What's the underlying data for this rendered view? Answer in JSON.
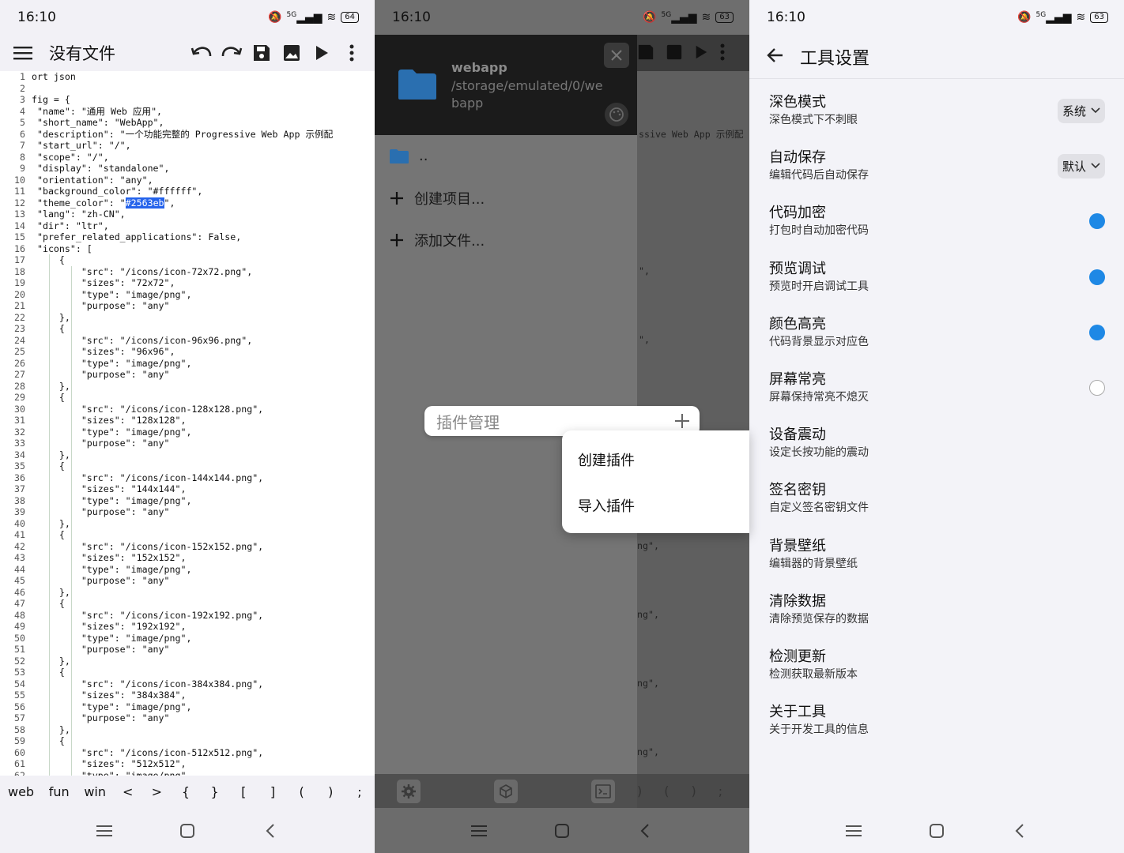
{
  "status": {
    "time": "16:10",
    "net": "5G",
    "battery_1": "64",
    "battery_2": "63",
    "battery_3": "63"
  },
  "editor": {
    "title": "没有文件",
    "lines": [
      [
        "1",
        "ort json"
      ],
      [
        "2",
        ""
      ],
      [
        "3",
        "fig = {"
      ],
      [
        "4",
        " \"name\": \"通用 Web 应用\","
      ],
      [
        "5",
        " \"short_name\": \"WebApp\","
      ],
      [
        "6",
        " \"description\": \"一个功能完整的 Progressive Web App 示例配"
      ],
      [
        "7",
        " \"start_url\": \"/\","
      ],
      [
        "8",
        " \"scope\": \"/\","
      ],
      [
        "9",
        " \"display\": \"standalone\","
      ],
      [
        "10",
        " \"orientation\": \"any\","
      ],
      [
        "11",
        " \"background_color\": \"#ffffff\","
      ],
      [
        "12",
        " \"theme_color\": \"#2563eb\","
      ],
      [
        "13",
        " \"lang\": \"zh-CN\","
      ],
      [
        "14",
        " \"dir\": \"ltr\","
      ],
      [
        "15",
        " \"prefer_related_applications\": False,"
      ],
      [
        "16",
        " \"icons\": ["
      ],
      [
        "17",
        "     {"
      ],
      [
        "18",
        "         \"src\": \"/icons/icon-72x72.png\","
      ],
      [
        "19",
        "         \"sizes\": \"72x72\","
      ],
      [
        "20",
        "         \"type\": \"image/png\","
      ],
      [
        "21",
        "         \"purpose\": \"any\""
      ],
      [
        "22",
        "     },"
      ],
      [
        "23",
        "     {"
      ],
      [
        "24",
        "         \"src\": \"/icons/icon-96x96.png\","
      ],
      [
        "25",
        "         \"sizes\": \"96x96\","
      ],
      [
        "26",
        "         \"type\": \"image/png\","
      ],
      [
        "27",
        "         \"purpose\": \"any\""
      ],
      [
        "28",
        "     },"
      ],
      [
        "29",
        "     {"
      ],
      [
        "30",
        "         \"src\": \"/icons/icon-128x128.png\","
      ],
      [
        "31",
        "         \"sizes\": \"128x128\","
      ],
      [
        "32",
        "         \"type\": \"image/png\","
      ],
      [
        "33",
        "         \"purpose\": \"any\""
      ],
      [
        "34",
        "     },"
      ],
      [
        "35",
        "     {"
      ],
      [
        "36",
        "         \"src\": \"/icons/icon-144x144.png\","
      ],
      [
        "37",
        "         \"sizes\": \"144x144\","
      ],
      [
        "38",
        "         \"type\": \"image/png\","
      ],
      [
        "39",
        "         \"purpose\": \"any\""
      ],
      [
        "40",
        "     },"
      ],
      [
        "41",
        "     {"
      ],
      [
        "42",
        "         \"src\": \"/icons/icon-152x152.png\","
      ],
      [
        "43",
        "         \"sizes\": \"152x152\","
      ],
      [
        "44",
        "         \"type\": \"image/png\","
      ],
      [
        "45",
        "         \"purpose\": \"any\""
      ],
      [
        "46",
        "     },"
      ],
      [
        "47",
        "     {"
      ],
      [
        "48",
        "         \"src\": \"/icons/icon-192x192.png\","
      ],
      [
        "49",
        "         \"sizes\": \"192x192\","
      ],
      [
        "50",
        "         \"type\": \"image/png\","
      ],
      [
        "51",
        "         \"purpose\": \"any\""
      ],
      [
        "52",
        "     },"
      ],
      [
        "53",
        "     {"
      ],
      [
        "54",
        "         \"src\": \"/icons/icon-384x384.png\","
      ],
      [
        "55",
        "         \"sizes\": \"384x384\","
      ],
      [
        "56",
        "         \"type\": \"image/png\","
      ],
      [
        "57",
        "         \"purpose\": \"any\""
      ],
      [
        "58",
        "     },"
      ],
      [
        "59",
        "     {"
      ],
      [
        "60",
        "         \"src\": \"/icons/icon-512x512.png\","
      ],
      [
        "61",
        "         \"sizes\": \"512x512\","
      ],
      [
        "62",
        "         \"type\": \"image/png\","
      ]
    ],
    "highlight_text": "#2563eb",
    "symbols": [
      "web",
      "fun",
      "win",
      "<",
      ">",
      "{",
      "}",
      "[",
      "]",
      "(",
      ")",
      ";"
    ]
  },
  "drawer": {
    "title": "webapp",
    "path": "/storage/emulated/0/webapp",
    "parent": "..",
    "create_project": "创建项目...",
    "add_file": "添加文件...",
    "bg_snippets": [
      "ssive Web App 示例配",
      "\",",
      "\",",
      "ng\",",
      "ng\",",
      "ng\",",
      "ng\","
    ],
    "bottom_symbols": [
      ")",
      "(",
      ")",
      ";"
    ]
  },
  "plugin": {
    "label": "插件管理",
    "menu": [
      "创建插件",
      "导入插件"
    ]
  },
  "settings": {
    "title": "工具设置",
    "items": [
      {
        "title": "深色模式",
        "sub": "深色模式下不刺眼",
        "control": "dropdown",
        "value": "系统"
      },
      {
        "title": "自动保存",
        "sub": "编辑代码后自动保存",
        "control": "dropdown",
        "value": "默认"
      },
      {
        "title": "代码加密",
        "sub": "打包时自动加密代码",
        "control": "on"
      },
      {
        "title": "预览调试",
        "sub": "预览时开启调试工具",
        "control": "on"
      },
      {
        "title": "颜色高亮",
        "sub": "代码背景显示对应色",
        "control": "on"
      },
      {
        "title": "屏幕常亮",
        "sub": "屏幕保持常亮不熄灭",
        "control": "off"
      },
      {
        "title": "设备震动",
        "sub": "设定长按功能的震动",
        "control": "none"
      },
      {
        "title": "签名密钥",
        "sub": "自定义签名密钥文件",
        "control": "none"
      },
      {
        "title": "背景壁纸",
        "sub": "编辑器的背景壁纸",
        "control": "none"
      },
      {
        "title": "清除数据",
        "sub": "清除预览保存的数据",
        "control": "none"
      },
      {
        "title": "检测更新",
        "sub": "检测获取最新版本",
        "control": "none"
      },
      {
        "title": "关于工具",
        "sub": "关于开发工具的信息",
        "control": "none"
      }
    ]
  },
  "colors": {
    "accent": "#1e88e5",
    "highlight": "#2563eb",
    "folder": "#2a6fb0"
  }
}
